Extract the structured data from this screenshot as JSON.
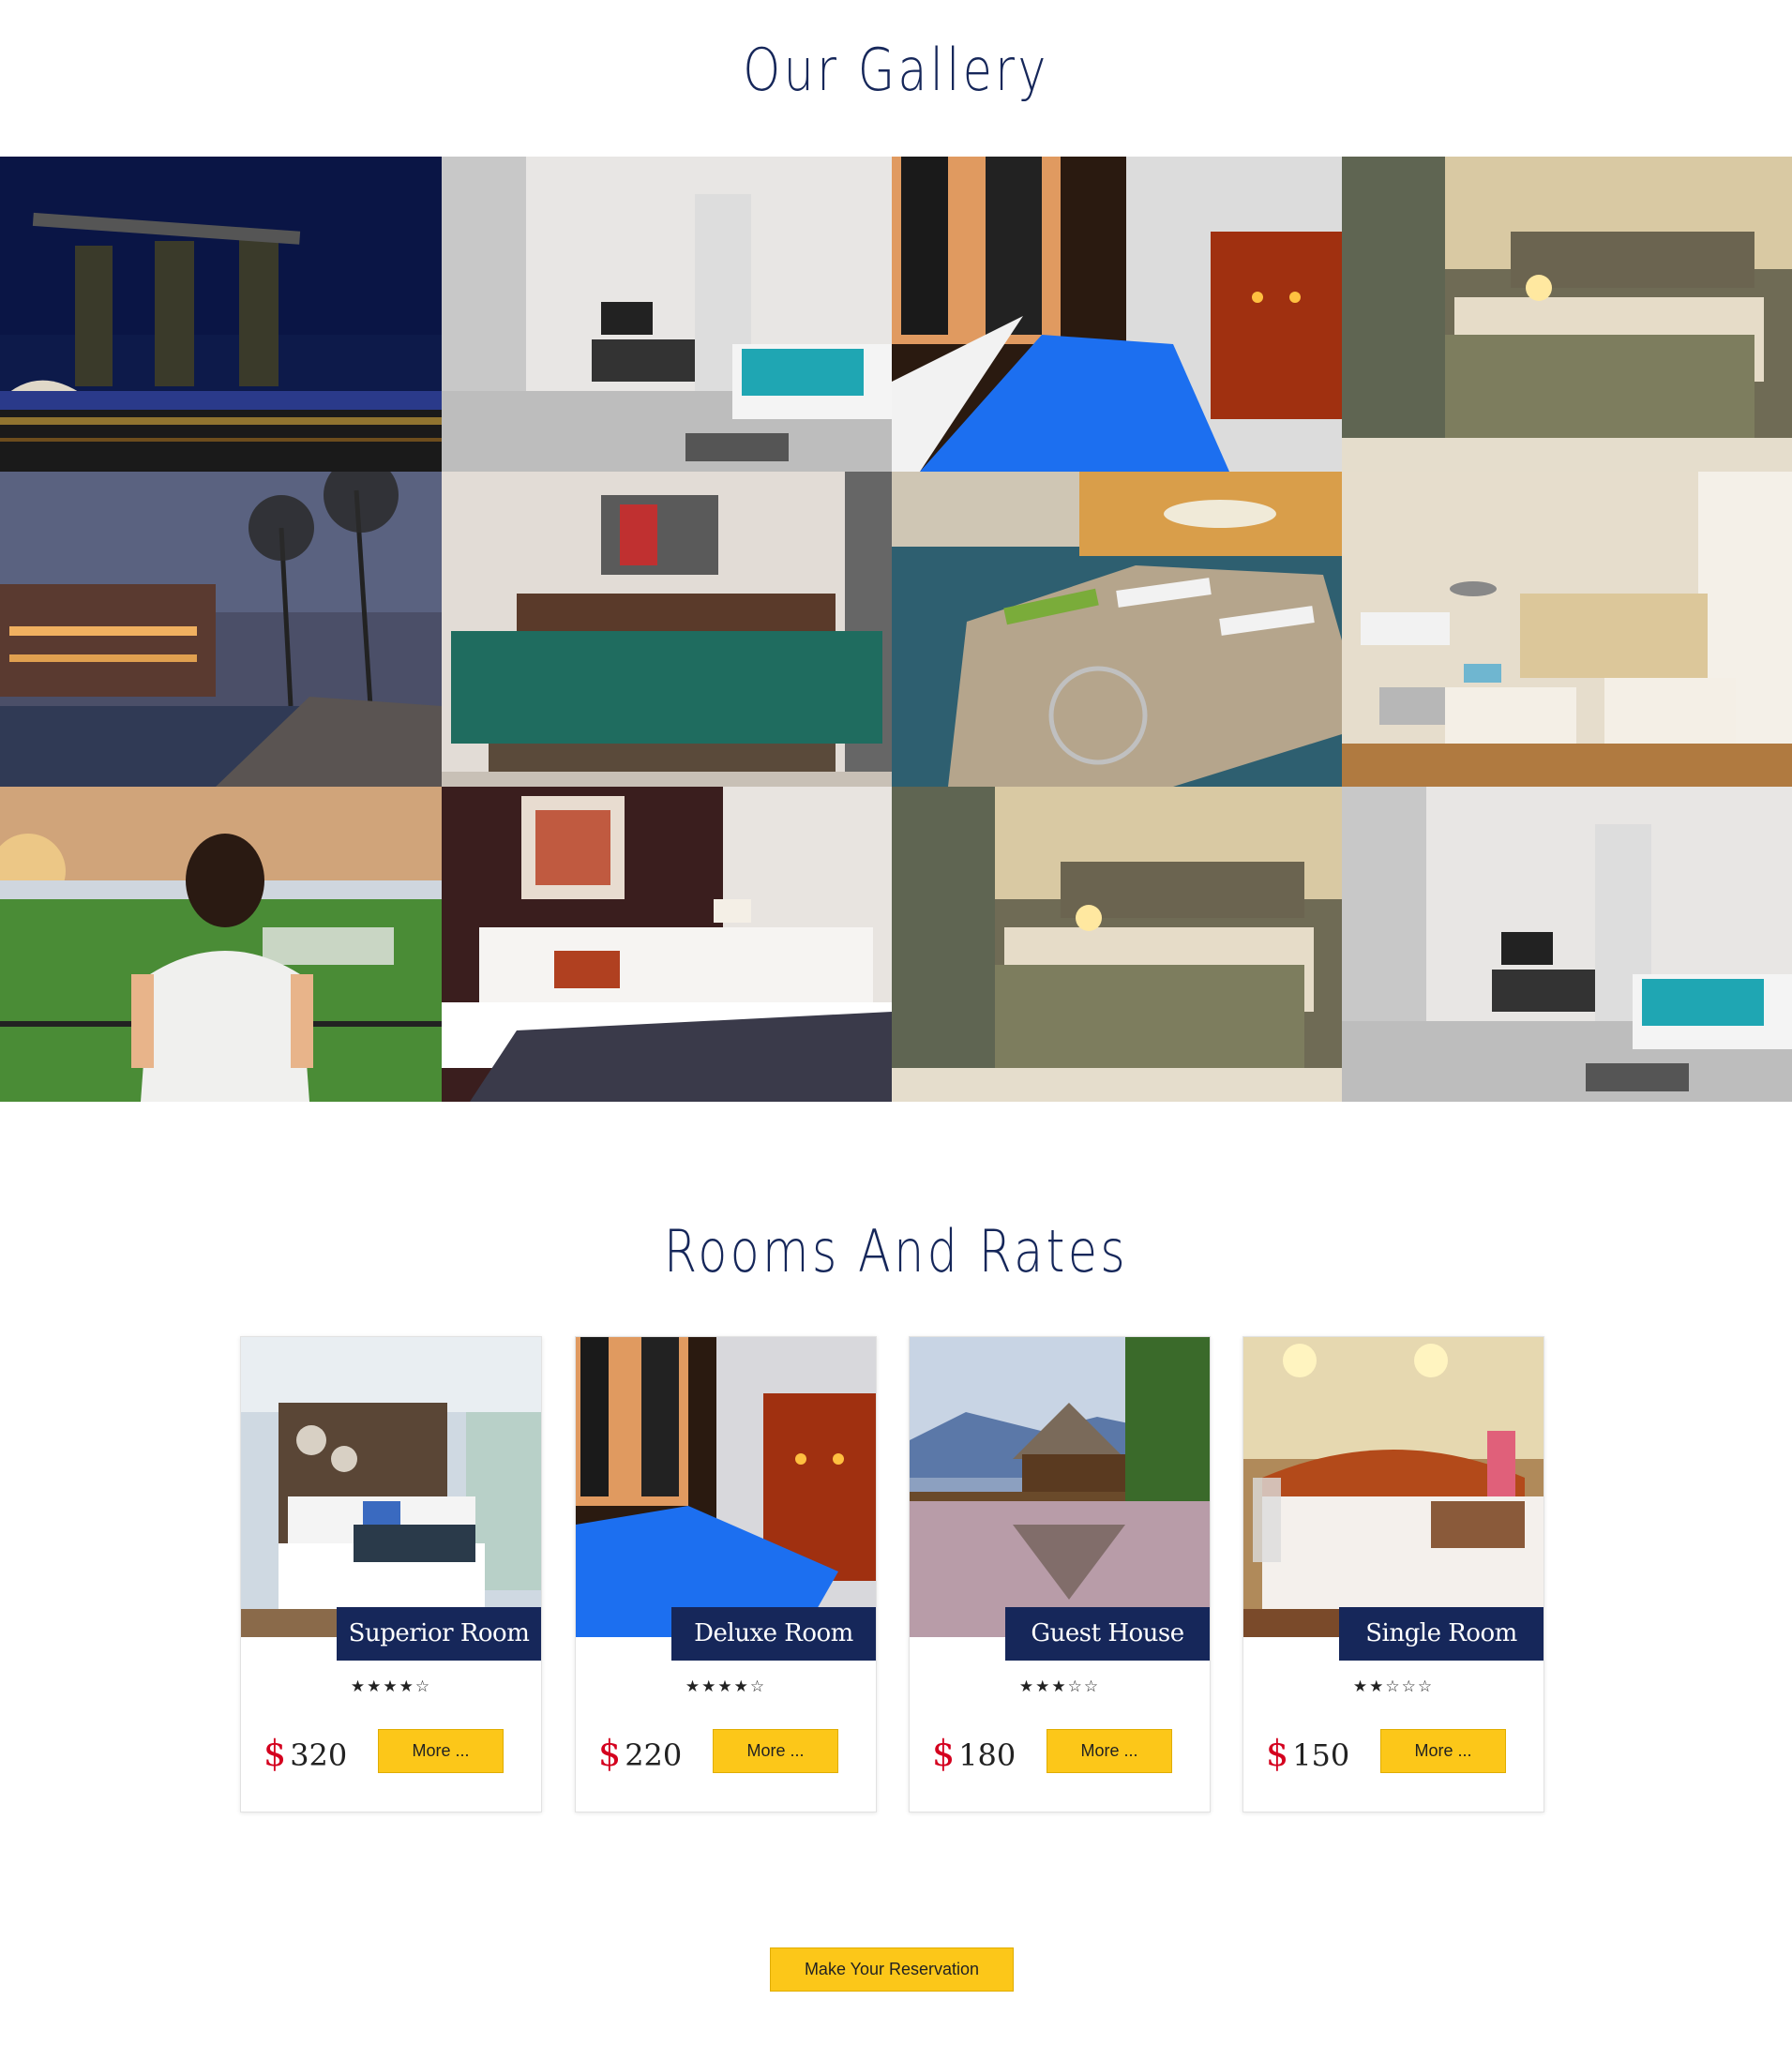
{
  "gallery": {
    "title": "Our Gallery",
    "images": [
      {
        "name": "marina-bay-night"
      },
      {
        "name": "bedroom-living-area"
      },
      {
        "name": "rooftop-pool-dusk"
      },
      {
        "name": "bedroom-green-bed"
      },
      {
        "name": "resort-palms-pool"
      },
      {
        "name": "twin-beds-room"
      },
      {
        "name": "infinity-pool-loungers"
      },
      {
        "name": "bright-room-two-beds"
      },
      {
        "name": "woman-overlooking-resort"
      },
      {
        "name": "bedroom-portrait-art"
      },
      {
        "name": "bedroom-green-bed-2"
      },
      {
        "name": "bedroom-living-area-2"
      }
    ]
  },
  "rooms": {
    "title": "Rooms And Rates",
    "currency_symbol": "$",
    "cards": [
      {
        "name": "Superior Room",
        "stars": "★★★★☆",
        "rating": 4,
        "price": "320",
        "more_label": "More ..."
      },
      {
        "name": "Deluxe Room",
        "stars": "★★★★☆",
        "rating": 4,
        "price": "220",
        "more_label": "More ..."
      },
      {
        "name": "Guest House",
        "stars": "★★★☆☆",
        "rating": 3,
        "price": "180",
        "more_label": "More ..."
      },
      {
        "name": "Single Room",
        "stars": "★★☆☆☆",
        "rating": 2,
        "price": "150",
        "more_label": "More ..."
      }
    ]
  },
  "reservation": {
    "label": "Make Your Reservation"
  },
  "colors": {
    "navy": "#16275a",
    "yellow": "#fcc719",
    "price_red": "#d4001e"
  }
}
